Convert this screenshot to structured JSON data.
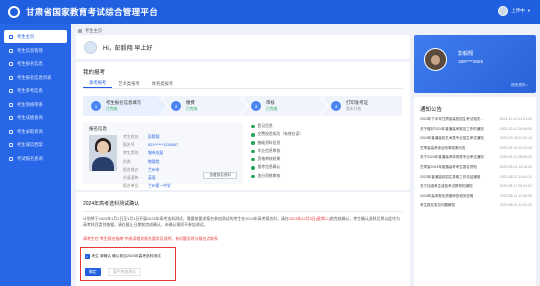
{
  "header": {
    "title": "甘肃省国家教育考试综合管理平台",
    "user_name": "上传中"
  },
  "sidebar": {
    "items": [
      {
        "label": "考生主页"
      },
      {
        "label": "考生信息管理"
      },
      {
        "label": "考生报名信息"
      },
      {
        "label": "考生报名信息列表"
      },
      {
        "label": "考生参考信息"
      },
      {
        "label": "考生资格审查"
      },
      {
        "label": "考生成绩查询"
      },
      {
        "label": "考生录取查询"
      },
      {
        "label": "考生诚信档案"
      },
      {
        "label": "考试报名查询"
      }
    ]
  },
  "breadcrumb": {
    "label": "考生主页"
  },
  "welcome": {
    "greeting": "Hi，彭毅翔 早上好"
  },
  "exam_card": {
    "title": "我的报考",
    "tabs": [
      "高考报考",
      "艺术类报考",
      "体育类报考"
    ],
    "steps": [
      {
        "name": "考生报名信息填写",
        "status": "已完成",
        "icon": "1"
      },
      {
        "name": "缴费",
        "status": "已完成",
        "icon": "2"
      },
      {
        "name": "审核",
        "status": "已完成",
        "icon": "3"
      },
      {
        "name": "打印准考证",
        "status": "暂未开放",
        "icon": "4"
      }
    ],
    "info": {
      "title": "报名信息",
      "rows": [
        {
          "label": "考生姓名:",
          "value": "彭毅翔"
        },
        {
          "label": "报名号:",
          "value": "621******1234567"
        },
        {
          "label": "考生类别:",
          "value": "城市应届"
        },
        {
          "label": "科类:",
          "value": "物理类"
        },
        {
          "label": "报名地点:",
          "value": "兰州市"
        },
        {
          "label": "外语语种:",
          "value": "英语"
        },
        {
          "label": "报名单位:",
          "value": "兰州第一中学"
        }
      ],
      "button": "查看报名资料"
    },
    "checklist": [
      "登记信息",
      "交费校验成功（有效在读）",
      "基础资料信息",
      "毕业信息审核",
      "资格审核结果",
      "报考信息确认",
      "加分资格审核"
    ]
  },
  "confirm": {
    "title": "2024年高考选科测试确认",
    "notice_pre": "计划将于2024年1月1日至1月1日开展2024年高考选科测试，需要按要求报名参加测试的考生在2024年高考报名时，请在",
    "notice_red": "2023年12月5日(星期二)",
    "notice_post": "前完成确认，考生确认选科后将以此作为高考科目类别依据，请在截止日期前完成确认，未确认视同不参加测试。",
    "warning": "请考生在\"考生报名指南\"中阅读相关报名要求及说明，有问题及时与报名点联系",
    "checkbox_label": "考生 请确认 确认参加2024年高考选科测试",
    "checkbox_mark": "✓",
    "primary_button": "确定",
    "ghost_button": "暂不参加测试"
  },
  "profile": {
    "name": "彭毅翔",
    "phone": "189****2825",
    "link": "修改资料 ›"
  },
  "notices": {
    "title": "通知公告",
    "items": [
      {
        "text": "2023年下半年甘肃省高校招生考试相关通知",
        "date": "2023-10-10 12:01:03"
      },
      {
        "text": "关于做好2024年普通高考报名工作的通知",
        "date": "2023-10-12 09:08:52"
      },
      {
        "text": "2024年普通高校艺术类专业招生考试通知",
        "date": "2023-09-28 11:22:14"
      },
      {
        "text": "甘肃省高考综合改革政策问答",
        "date": "2023-09-15 10:31:45"
      },
      {
        "text": "关于2024年普通高考体育类专业考试通知",
        "date": "2023-09-12 08:45:20"
      },
      {
        "text": "甘肃省2024年普通高考考生报名须知",
        "date": "2023-09-01 14:16:03"
      },
      {
        "text": "2023年普通高校招生录取工作总结通报",
        "date": "2023-08-27 16:41:11"
      },
      {
        "text": "关于加强考生诚信考试教育的通知",
        "date": "2023-08-17 09:21:57"
      },
      {
        "text": "2024年高考报名资格审查相关说明",
        "date": "2023-08-11 12:36:09"
      },
      {
        "text": "考生报名常见问题解答",
        "date": "2023-08-01 11:02:23"
      }
    ]
  }
}
